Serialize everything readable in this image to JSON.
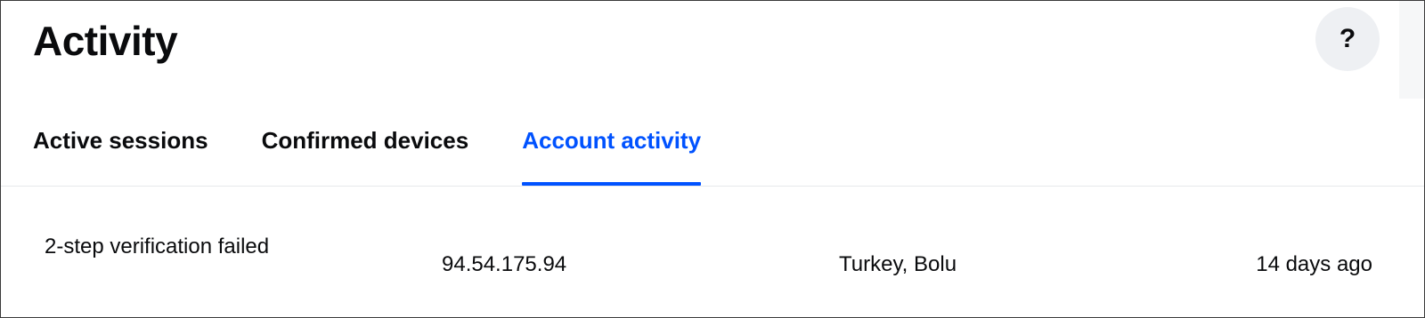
{
  "header": {
    "title": "Activity",
    "help_label": "?"
  },
  "tabs": [
    {
      "label": "Active sessions",
      "active": false
    },
    {
      "label": "Confirmed devices",
      "active": false
    },
    {
      "label": "Account activity",
      "active": true
    }
  ],
  "activity": {
    "rows": [
      {
        "event": "2-step verification failed",
        "ip": "94.54.175.94",
        "location": "Turkey, Bolu",
        "time": "14 days ago"
      }
    ]
  },
  "colors": {
    "accent": "#0052ff",
    "text": "#0a0b0d",
    "help_bg": "#eef0f3",
    "divider": "#e6e8eb"
  },
  "icons": {
    "help": "question-mark-icon"
  }
}
